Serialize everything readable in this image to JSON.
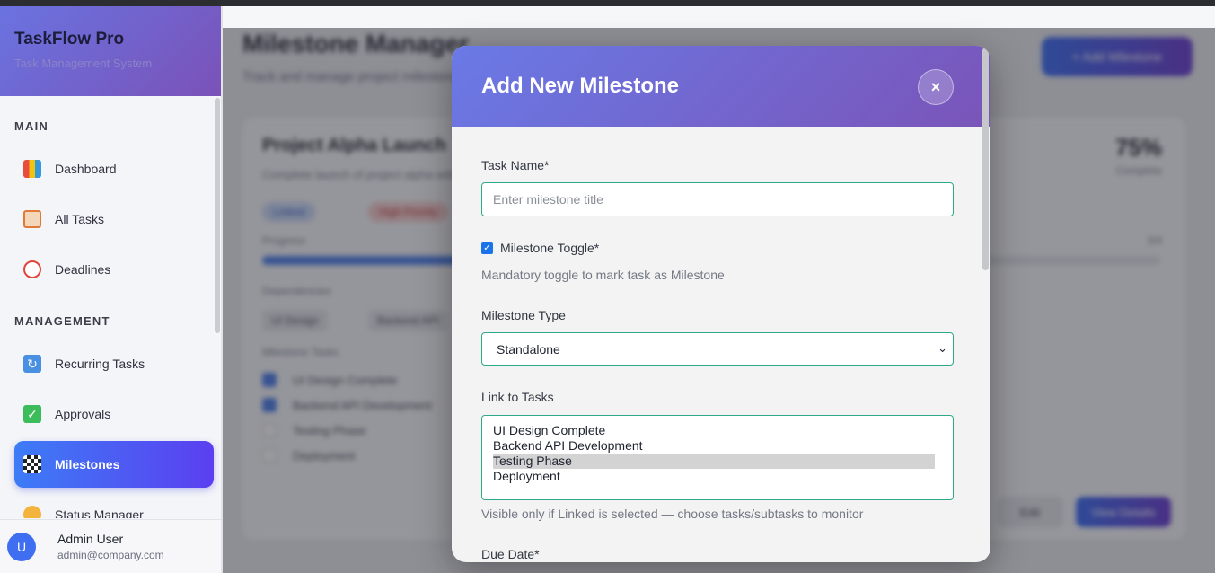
{
  "sidebar": {
    "brand_title": "TaskFlow Pro",
    "brand_subtitle": "Task Management System",
    "sections": {
      "main": "MAIN",
      "management": "MANAGEMENT"
    },
    "items": [
      {
        "label": "Dashboard",
        "icon": "chart-icon"
      },
      {
        "label": "All Tasks",
        "icon": "clipboard-icon"
      },
      {
        "label": "Deadlines",
        "icon": "alarm-clock-icon"
      },
      {
        "label": "Recurring Tasks",
        "icon": "recurring-icon"
      },
      {
        "label": "Approvals",
        "icon": "checkmark-icon"
      },
      {
        "label": "Milestones",
        "icon": "checkered-flag-icon",
        "active": true
      },
      {
        "label": "Status Manager",
        "icon": "status-icon"
      }
    ],
    "user": {
      "initial": "U",
      "name": "Admin User",
      "email": "admin@company.com"
    }
  },
  "main": {
    "title": "Milestone Manager",
    "subtitle": "Track and manage project milestones",
    "add_button": "+ Add Milestone",
    "card": {
      "title": "Project Alpha Launch",
      "description": "Complete launch of project alpha with all features",
      "percent": "75%",
      "percent_label": "Complete",
      "tags": [
        "Linked",
        "High Priority"
      ],
      "progress_label": "Progress",
      "progress_value": "3/4",
      "progress_fraction": 0.75,
      "dependencies_label": "Dependencies",
      "dependencies": [
        "UI Design",
        "Backend API"
      ],
      "checklist_label": "Milestone Tasks",
      "checklist": [
        {
          "label": "UI Design Complete",
          "done": true
        },
        {
          "label": "Backend API Development",
          "done": true
        },
        {
          "label": "Testing Phase",
          "done": false
        },
        {
          "label": "Deployment",
          "done": false
        }
      ],
      "edit_button": "Edit",
      "view_button": "View Details"
    }
  },
  "modal": {
    "title": "Add New Milestone",
    "close_label": "×",
    "task_name_label": "Task Name*",
    "task_name_placeholder": "Enter milestone title",
    "task_name_value": "",
    "toggle_label": "Milestone Toggle*",
    "toggle_checked": true,
    "toggle_help": "Mandatory toggle to mark task as Milestone",
    "type_label": "Milestone Type",
    "type_value": "Standalone",
    "link_label": "Link to Tasks",
    "link_options": [
      "UI Design Complete",
      "Backend API Development",
      "Testing Phase",
      "Deployment"
    ],
    "link_selected": "Testing Phase",
    "link_help": "Visible only if Linked is selected — choose tasks/subtasks to monitor",
    "due_label": "Due Date*"
  },
  "colors": {
    "accent": "#2fa88a",
    "header_gradient_start": "#6a7ae6",
    "header_gradient_end": "#7a54b8",
    "active_nav_start": "#3d7cf6",
    "active_nav_end": "#5b3ff0"
  }
}
